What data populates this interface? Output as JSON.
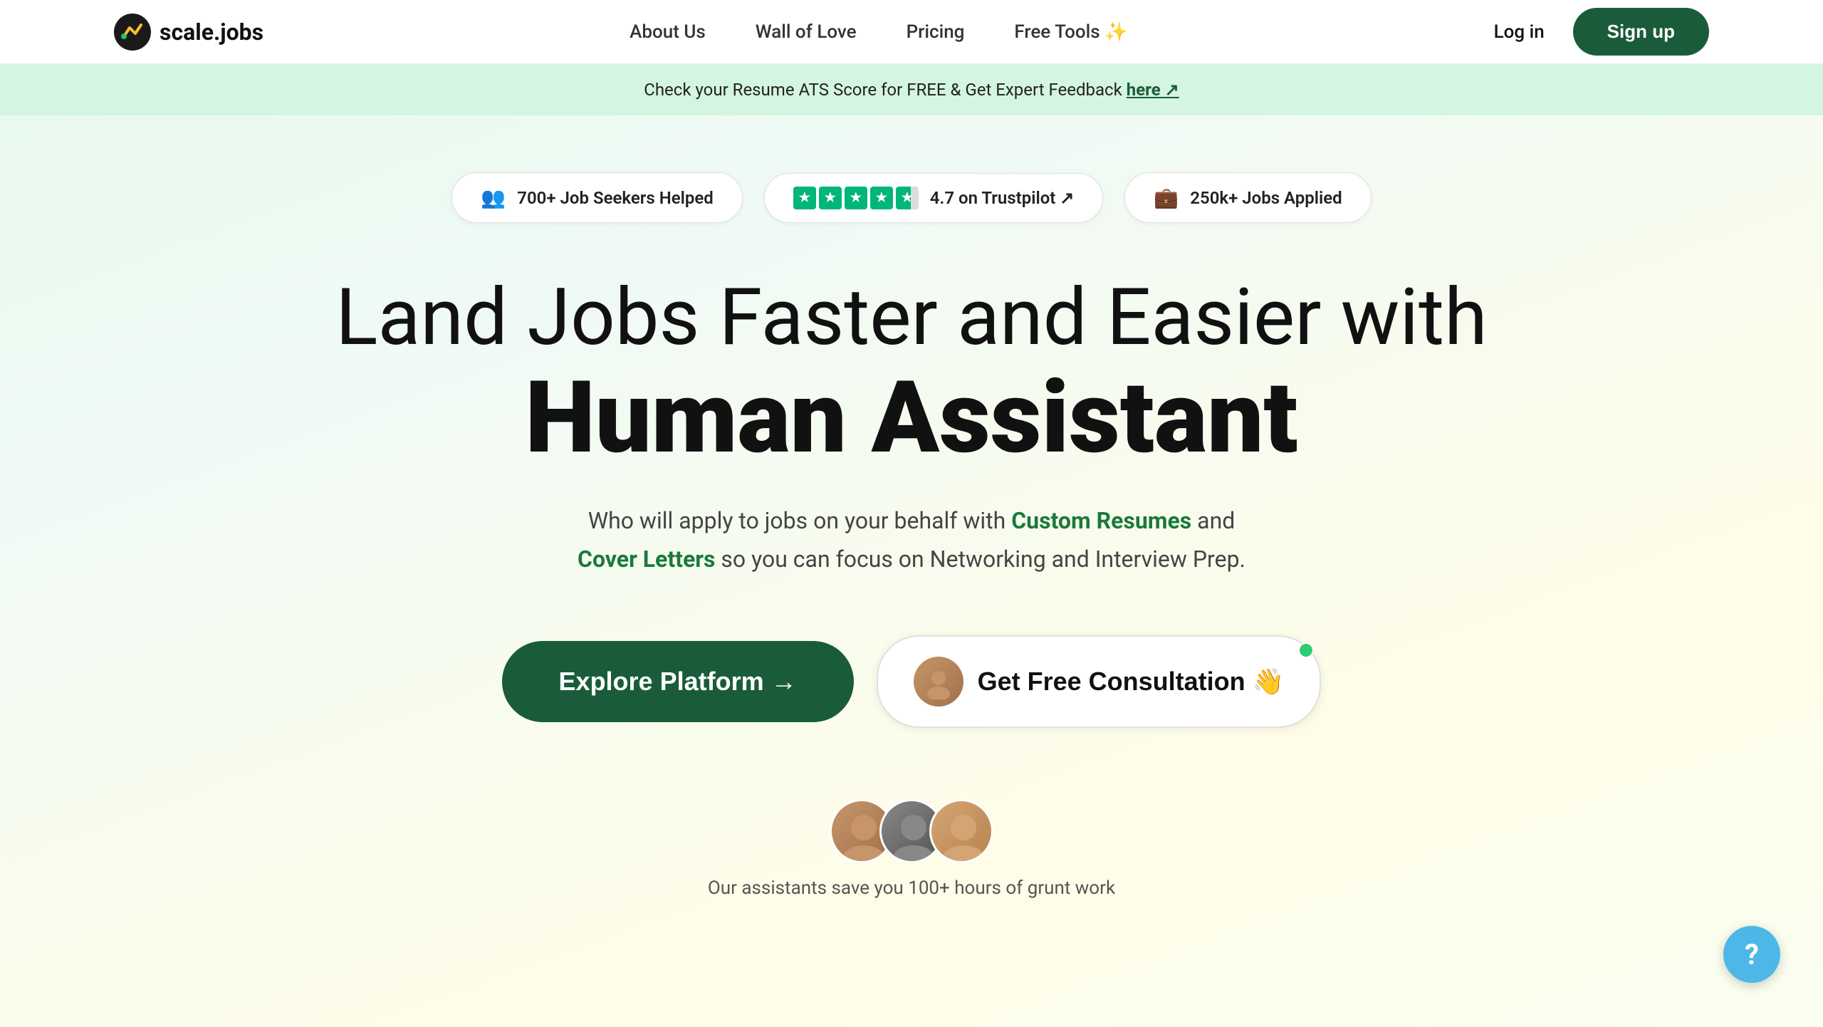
{
  "nav": {
    "logo_text": "scale.jobs",
    "links": [
      {
        "label": "About Us",
        "id": "about-us"
      },
      {
        "label": "Wall of Love",
        "id": "wall-of-love"
      },
      {
        "label": "Pricing",
        "id": "pricing"
      },
      {
        "label": "Free Tools ✨",
        "id": "free-tools"
      }
    ],
    "login_label": "Log in",
    "signup_label": "Sign up"
  },
  "announcement": {
    "text": "Check your Resume ATS Score for FREE & Get Expert Feedback ",
    "link_text": "here ↗"
  },
  "hero": {
    "stats": [
      {
        "icon": "👥",
        "text": "700+ Job Seekers Helped"
      },
      {
        "trustpilot": true,
        "rating": "4.7",
        "label": "4.7 on Trustpilot ↗"
      },
      {
        "icon": "💼",
        "text": "250k+ Jobs Applied"
      }
    ],
    "title_line1": "Land Jobs Faster and Easier with",
    "title_line2": "Human Assistant",
    "subtitle_before": "Who will apply to jobs on your behalf with ",
    "subtitle_highlight1": "Custom Resumes",
    "subtitle_middle": " and",
    "subtitle_newline": "",
    "subtitle_highlight2": "Cover Letters",
    "subtitle_after": " so you can focus on Networking and Interview Prep.",
    "cta_explore": "Explore Platform →",
    "cta_consultation": "Get Free Consultation 👋",
    "bottom_text": "Our assistants save you 100+ hours of grunt work"
  },
  "help": {
    "label": "?"
  },
  "colors": {
    "primary_green": "#1a5c3a",
    "light_green_text": "#1a7a3a",
    "accent_green": "#2ecc71",
    "trustpilot_green": "#00b67a"
  }
}
